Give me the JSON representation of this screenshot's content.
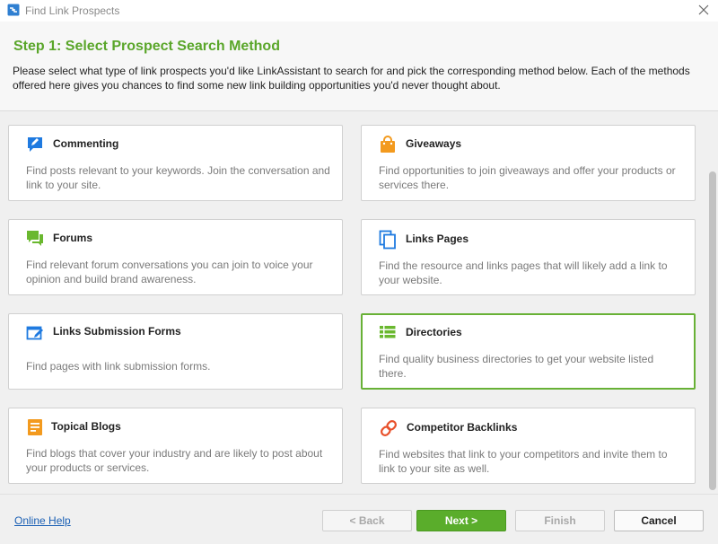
{
  "window": {
    "title": "Find Link Prospects",
    "icon": "app-logo-icon",
    "close_icon": "close-icon"
  },
  "header": {
    "step_title": "Step 1: Select Prospect Search Method",
    "description": "Please select what type of link prospects you'd like LinkAssistant to search for and pick the corresponding method below. Each of the methods offered here gives you chances to find some new link building opportunities you'd never thought about."
  },
  "methods": [
    {
      "title": "Commenting",
      "description": "Find posts relevant to your keywords. Join the conversation and link to your site.",
      "icon": "comment-pen-icon",
      "selected": false
    },
    {
      "title": "Giveaways",
      "description": "Find opportunities to join giveaways and offer your products or services there.",
      "icon": "shopping-bag-icon",
      "selected": false
    },
    {
      "title": "Forums",
      "description": "Find relevant forum conversations you can join to voice your opinion and build brand awareness.",
      "icon": "chat-bubbles-icon",
      "selected": false
    },
    {
      "title": "Links Pages",
      "description": "Find the resource and links pages that will likely add a link to your website.",
      "icon": "copy-pages-icon",
      "selected": false
    },
    {
      "title": "Links Submission Forms",
      "description": "Find pages with link submission forms.",
      "icon": "form-edit-icon",
      "selected": false
    },
    {
      "title": "Directories",
      "description": "Find quality business directories to get your website listed there.",
      "icon": "list-grid-icon",
      "selected": true
    },
    {
      "title": "Topical Blogs",
      "description": "Find blogs that cover your industry and are likely to post about your products or services.",
      "icon": "document-lines-icon",
      "selected": false
    },
    {
      "title": "Competitor Backlinks",
      "description": "Find websites that link to your competitors and invite them to link to your site as well.",
      "icon": "chain-link-icon",
      "selected": false
    }
  ],
  "footer": {
    "help_link": "Online Help",
    "back_label": "< Back",
    "next_label": "Next >",
    "finish_label": "Finish",
    "cancel_label": "Cancel"
  },
  "colors": {
    "accent_green": "#5aa62a",
    "icon_blue": "#1f7ae0",
    "icon_orange": "#f39a1e",
    "icon_green": "#6ab82f",
    "icon_red": "#e8502a",
    "link_blue": "#1a5fb4"
  }
}
